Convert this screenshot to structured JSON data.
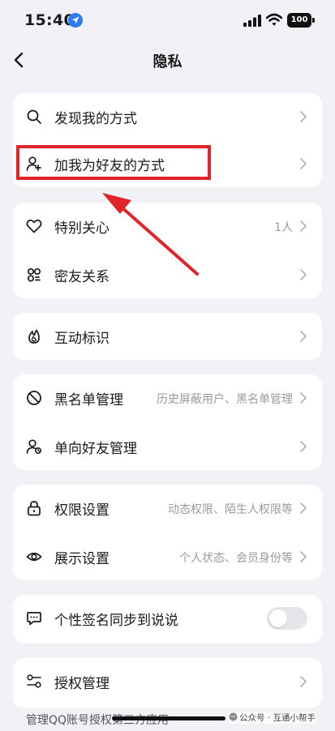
{
  "status_bar": {
    "time": "15:40",
    "battery": "100"
  },
  "header": {
    "title": "隐私"
  },
  "sections": [
    {
      "items": [
        {
          "label": "发现我的方式",
          "icon": "search-icon"
        },
        {
          "label": "加我为好友的方式",
          "icon": "add-friend-icon"
        }
      ]
    },
    {
      "items": [
        {
          "label": "特别关心",
          "icon": "heart-icon",
          "value": "1人"
        },
        {
          "label": "密友关系",
          "icon": "close-friends-icon"
        }
      ]
    },
    {
      "items": [
        {
          "label": "互动标识",
          "icon": "flame-icon"
        }
      ]
    },
    {
      "items": [
        {
          "label": "黑名单管理",
          "icon": "block-icon",
          "value": "历史屏蔽用户、黑名单管理"
        },
        {
          "label": "单向好友管理",
          "icon": "one-way-friend-icon"
        }
      ]
    },
    {
      "items": [
        {
          "label": "权限设置",
          "icon": "lock-icon",
          "value": "动态权限、陌生人权限等"
        },
        {
          "label": "展示设置",
          "icon": "eye-icon",
          "value": "个人状态、会员身份等"
        }
      ]
    },
    {
      "items": [
        {
          "label": "个性签名同步到说说",
          "icon": "signature-sync-icon",
          "toggle": false
        }
      ]
    },
    {
      "items": [
        {
          "label": "授权管理",
          "icon": "authorization-icon"
        }
      ]
    }
  ],
  "footer": {
    "text": "管理QQ账号授权第三方应用",
    "watermark": "公众号 · 互通小帮手"
  },
  "annotation": {
    "color": "#e0242a"
  }
}
